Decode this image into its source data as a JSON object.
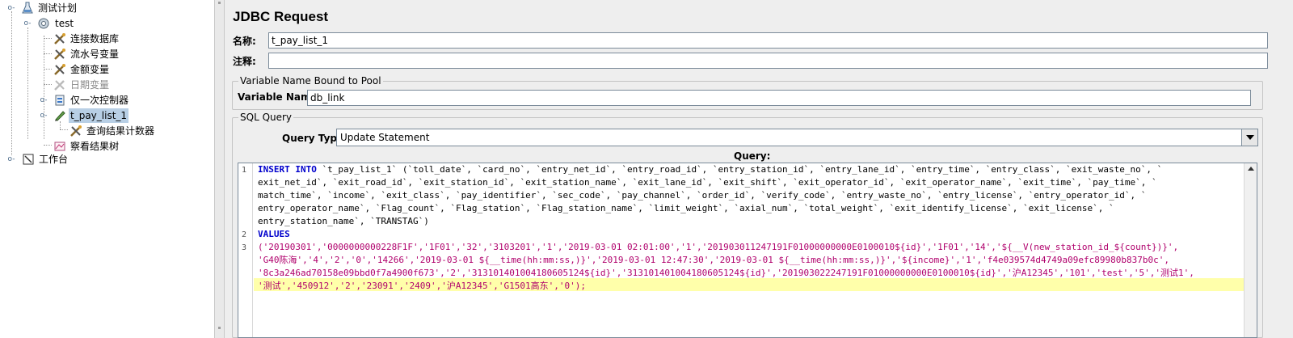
{
  "tree": {
    "items": [
      {
        "label": "测试计划",
        "icon": "test-plan-icon"
      },
      {
        "label": "test",
        "icon": "thread-group-gear-icon"
      },
      {
        "label": "连接数据库",
        "icon": "config-wrench-icon"
      },
      {
        "label": "流水号变量",
        "icon": "config-wrench-icon"
      },
      {
        "label": "金额变量",
        "icon": "config-wrench-icon"
      },
      {
        "label": "日期变量",
        "icon": "config-wrench-disabled-icon"
      },
      {
        "label": "仅一次控制器",
        "icon": "controller-icon"
      },
      {
        "label": "t_pay_list_1",
        "icon": "sampler-pen-icon"
      },
      {
        "label": "查询结果计数器",
        "icon": "config-wrench-icon"
      },
      {
        "label": "察看结果树",
        "icon": "listener-chart-icon"
      },
      {
        "label": "工作台",
        "icon": "workbench-icon"
      }
    ]
  },
  "editor": {
    "title": "JDBC Request",
    "name_label": "名称:",
    "name_value": "t_pay_list_1",
    "comment_label": "注释:",
    "comment_value": "",
    "pool_section": {
      "legend": "Variable Name Bound to Pool",
      "label": "Variable Name:",
      "value": "db_link"
    },
    "sql_section": {
      "legend": "SQL Query",
      "query_type_label": "Query Type:",
      "query_type_value": "Update Statement",
      "query_label": "Query:"
    },
    "code": {
      "line_numbers": [
        "1",
        "2",
        "3"
      ],
      "lines": [
        {
          "kw": "INSERT INTO",
          "text": " `t_pay_list_1` (`toll_date`, `card_no`, `entry_net_id`, `entry_road_id`, `entry_station_id`, `entry_lane_id`, `entry_time`, `entry_class`, `exit_waste_no`, `"
        },
        {
          "kw": "",
          "text": "exit_net_id`, `exit_road_id`, `exit_station_id`, `exit_station_name`, `exit_lane_id`, `exit_shift`, `exit_operator_id`, `exit_operator_name`, `exit_time`, `pay_time`, `"
        },
        {
          "kw": "",
          "text": "match_time`, `income`, `exit_class`, `pay_identifier`, `sec_code`, `pay_channel`, `order_id`, `verify_code`, `entry_waste_no`, `entry_license`, `entry_operator_id`, `"
        },
        {
          "kw": "",
          "text": "entry_operator_name`, `Flag_count`, `Flag_station`, `Flag_station_name`, `limit_weight`, `axial_num`, `total_weight`, `exit_identify_license`, `exit_license`, `"
        },
        {
          "kw": "",
          "text": "entry_station_name`, `TRANSTAG`)"
        },
        {
          "kw": "VALUES",
          "text": ""
        },
        {
          "kw": "",
          "str": "('20190301','0000000000228F1F','1F01','32','3103201','1','2019-03-01 02:01:00','1','201903011247191F01000000000E0100010${id}','1F01','14','${__V(new_station_id_${count})}',"
        },
        {
          "kw": "",
          "str": "'G40陈海','4','2','0','14266','2019-03-01 ${__time(hh:mm:ss,)}','2019-03-01 12:47:30','2019-03-01 ${__time(hh:mm:ss,)}','${income}','1','f4e039574d4749a09efc89980b837b0c',"
        },
        {
          "kw": "",
          "str": "'8c3a246ad70158e09bbd0f7a4900f673','2','313101401004180605124${id}','313101401004180605124${id}','201903022247191F01000000000E0100010${id}','沪A12345','101','test','5','测试1',"
        },
        {
          "kw": "",
          "str": "'测试','450912','2','23091','2409','沪A12345','G1501高东','0');"
        }
      ]
    }
  },
  "colors": {
    "keyword": "#0000cc",
    "string": "#b0006c",
    "current_line_highlight": "#ffffaa",
    "selection": "#b8cfe5"
  }
}
